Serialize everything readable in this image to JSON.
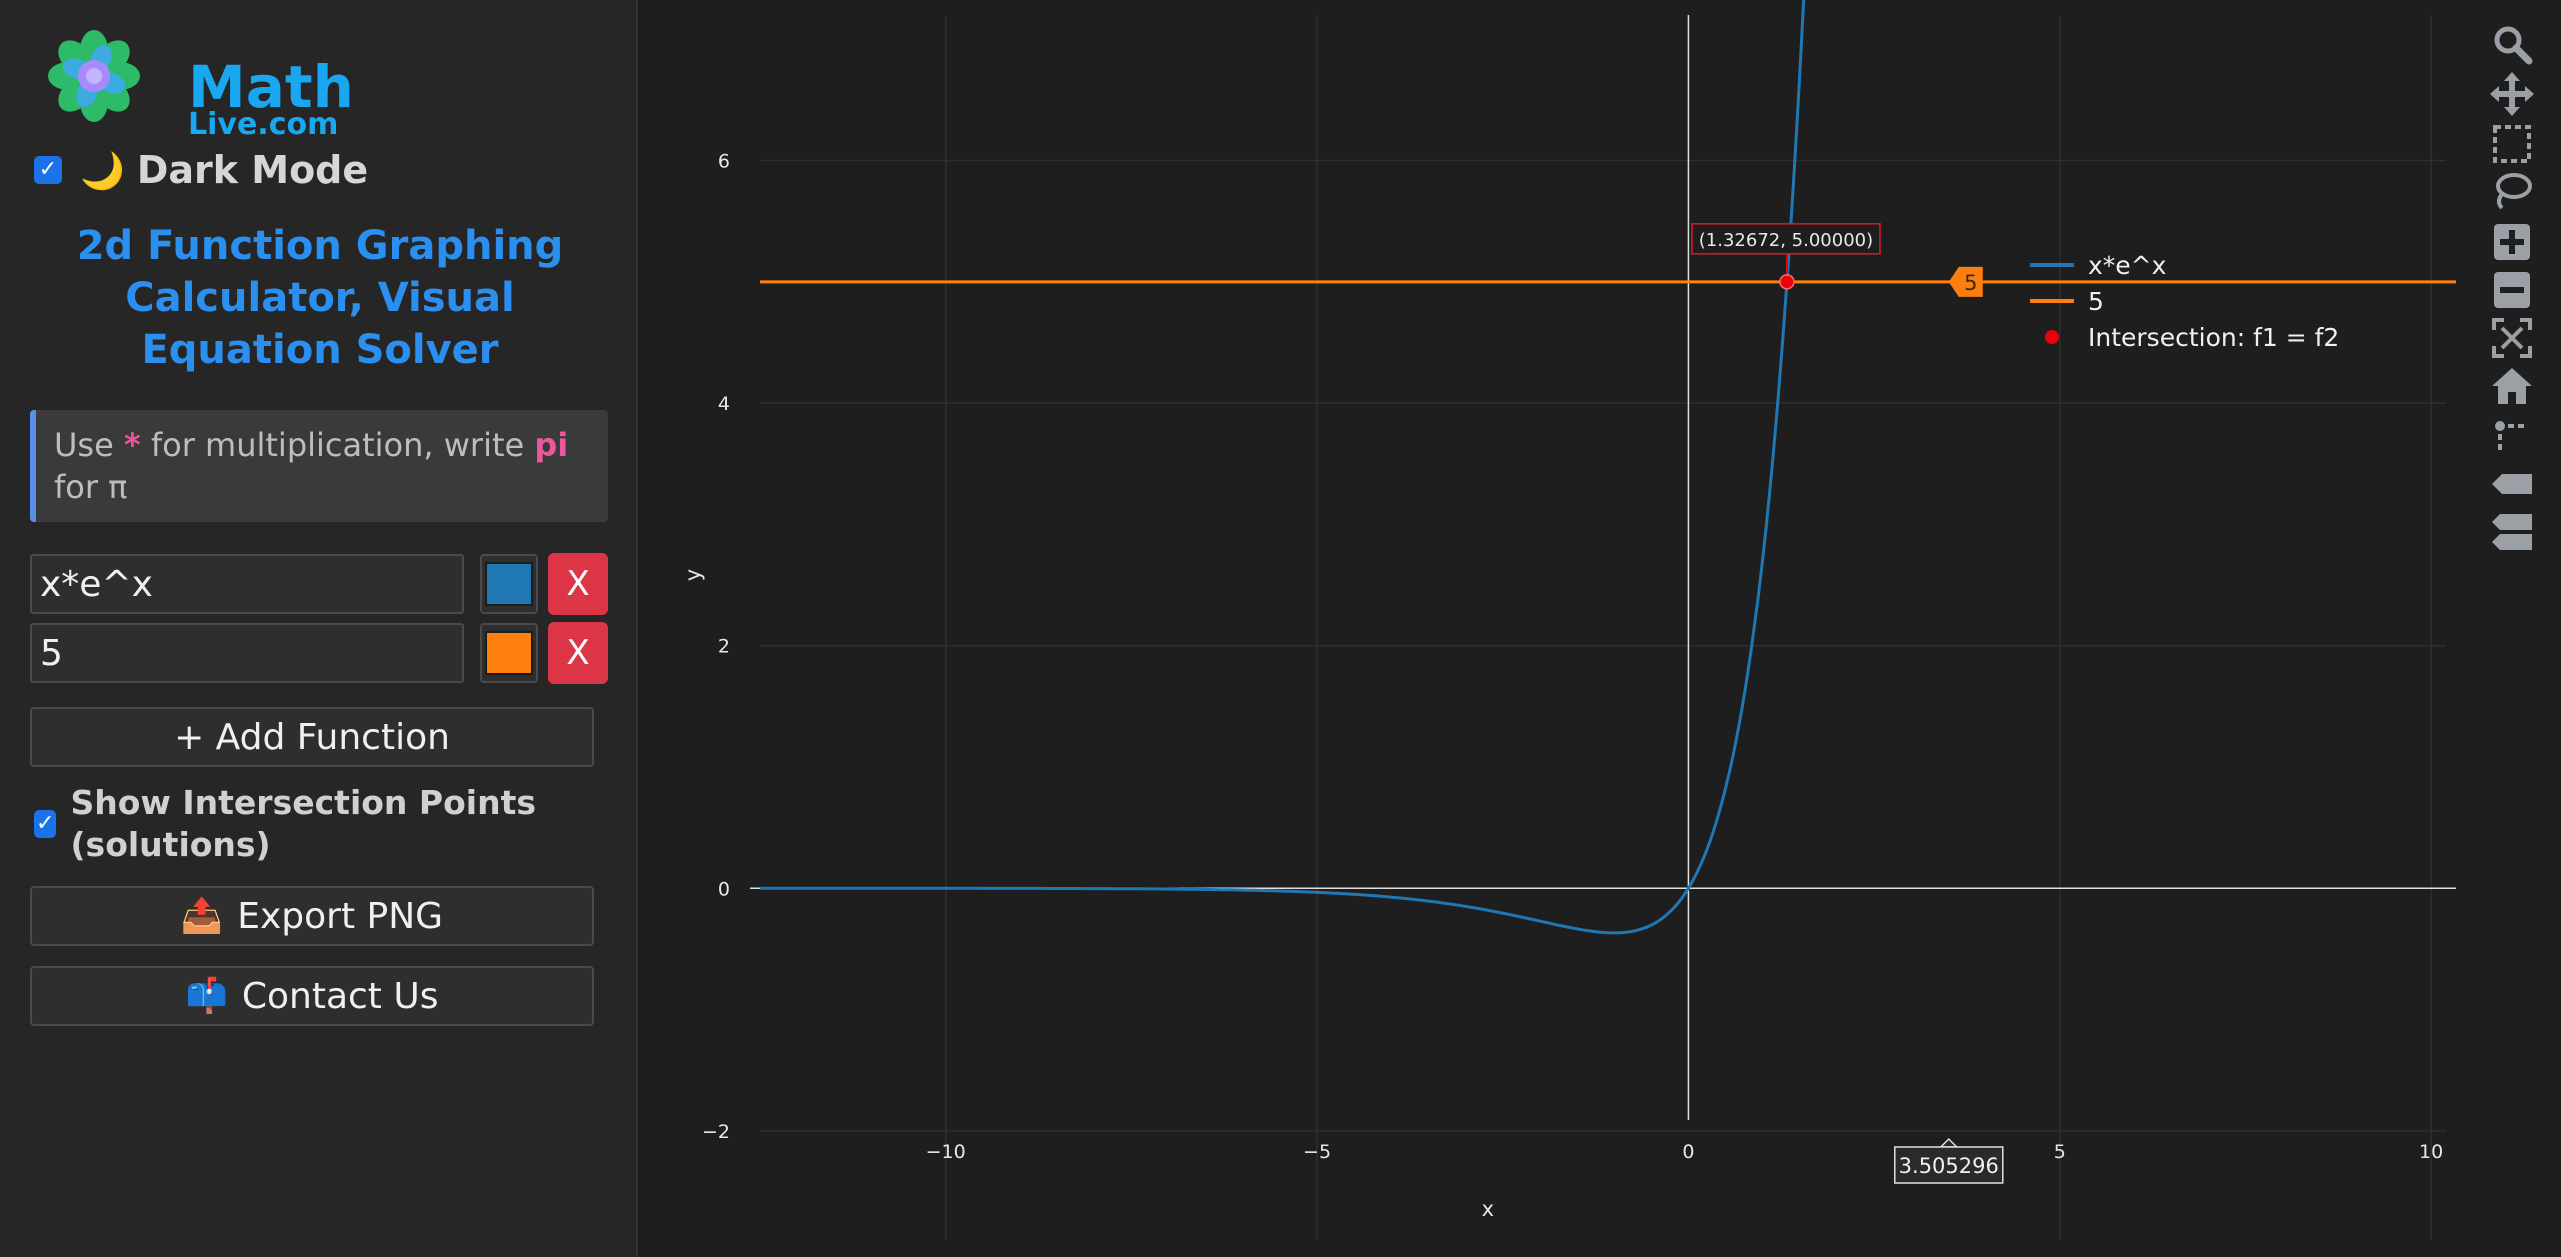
{
  "brand": {
    "name_line1": "Math",
    "name_line2": "Live.com",
    "logo_icon": "flower-logo-icon"
  },
  "dark_mode": {
    "checked": true,
    "icon": "moon-icon",
    "label": "Dark Mode"
  },
  "title": "2d Function Graphing Calculator, Visual Equation Solver",
  "hint": {
    "prefix": "Use ",
    "star": "*",
    "middle": " for multiplication, write ",
    "pi_word": "pi",
    "suffix": " for π"
  },
  "functions": [
    {
      "expression": "x*e^x",
      "color": "#1f77b4",
      "remove_label": "X"
    },
    {
      "expression": "5",
      "color": "#ff7f0e",
      "remove_label": "X"
    }
  ],
  "add_function_label": "+ Add Function",
  "show_intersections": {
    "checked": true,
    "label": "Show Intersection Points (solutions)"
  },
  "export_png": {
    "icon": "outbox-tray-icon",
    "label": "Export PNG"
  },
  "contact_us": {
    "icon": "mailbox-icon",
    "label": "Contact Us"
  },
  "colors": {
    "background": "#1e1e1e",
    "sidebar": "#262626",
    "accent": "#2b8ff0",
    "danger": "#dc3545",
    "intersection": "#e8000b"
  },
  "chart_data": {
    "type": "line",
    "xlabel": "x",
    "ylabel": "y",
    "xlim": [
      -12.5,
      10.2
    ],
    "ylim": [
      -2.9,
      7.2
    ],
    "x_ticks": [
      -10,
      -5,
      0,
      5,
      10
    ],
    "x_tick_labels": [
      "−10",
      "−5",
      "0",
      "5",
      "10"
    ],
    "y_ticks": [
      -2,
      0,
      2,
      4,
      6
    ],
    "y_tick_labels": [
      "−2",
      "0",
      "2",
      "4",
      "6"
    ],
    "grid": true,
    "legend_position": "top-right",
    "series": [
      {
        "name": "x*e^x",
        "color": "#1f77b4",
        "function": "x*e^x"
      },
      {
        "name": "5",
        "color": "#ff7f0e",
        "function": "5"
      }
    ],
    "intersection": {
      "name": "Intersection: f1 = f2",
      "x": 1.32672,
      "y": 5.0,
      "label": "(1.32672, 5.00000)"
    },
    "hover_y_label": "5",
    "hover_x_label": "3.505296",
    "hover_x": 3.505296
  },
  "modebar": [
    {
      "icon": "zoom-icon"
    },
    {
      "icon": "pan-icon"
    },
    {
      "icon": "box-select-icon"
    },
    {
      "icon": "lasso-select-icon"
    },
    {
      "icon": "zoom-in-icon"
    },
    {
      "icon": "zoom-out-icon"
    },
    {
      "icon": "autoscale-icon"
    },
    {
      "icon": "reset-axes-icon"
    },
    {
      "icon": "spike-lines-icon"
    },
    {
      "icon": "hover-closest-icon"
    },
    {
      "icon": "hover-compare-icon"
    }
  ]
}
